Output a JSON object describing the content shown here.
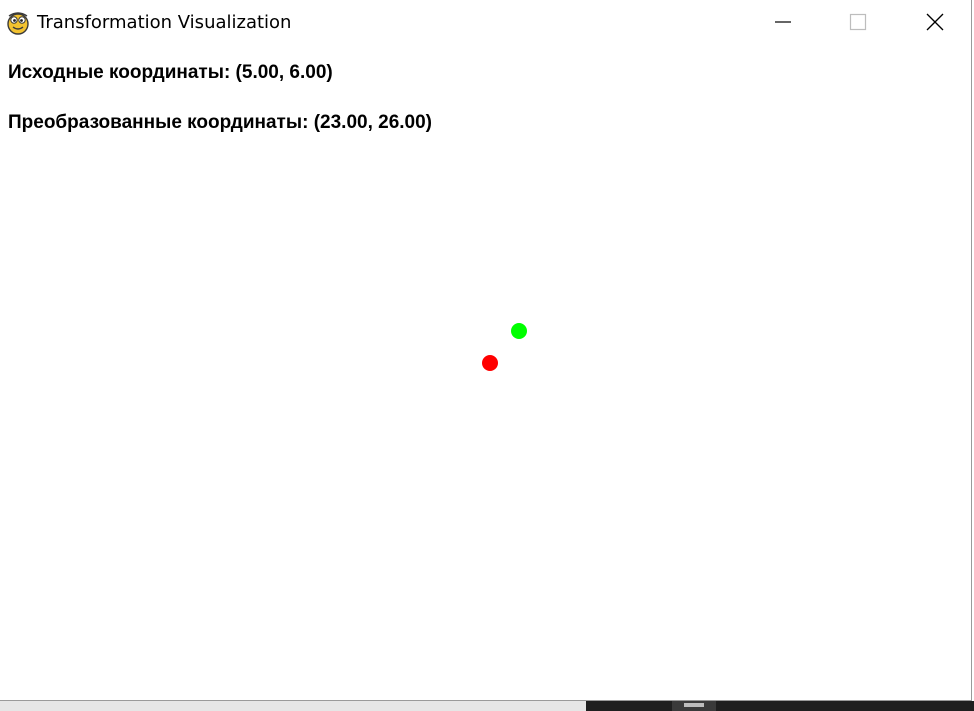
{
  "window": {
    "title": "Transformation Visualization",
    "app_icon": "python-snake-icon",
    "controls": {
      "minimize_icon": "minimize-icon",
      "maximize_icon": "maximize-icon",
      "close_icon": "close-icon"
    }
  },
  "content": {
    "original_label": "Исходные координаты: (5.00, 6.00)",
    "transformed_label": "Преобразованные координаты: (23.00, 26.00)",
    "points": {
      "original": {
        "x": 5.0,
        "y": 6.0,
        "color": "#ff0000"
      },
      "transformed": {
        "x": 23.0,
        "y": 26.0,
        "color": "#00ff00"
      }
    }
  }
}
